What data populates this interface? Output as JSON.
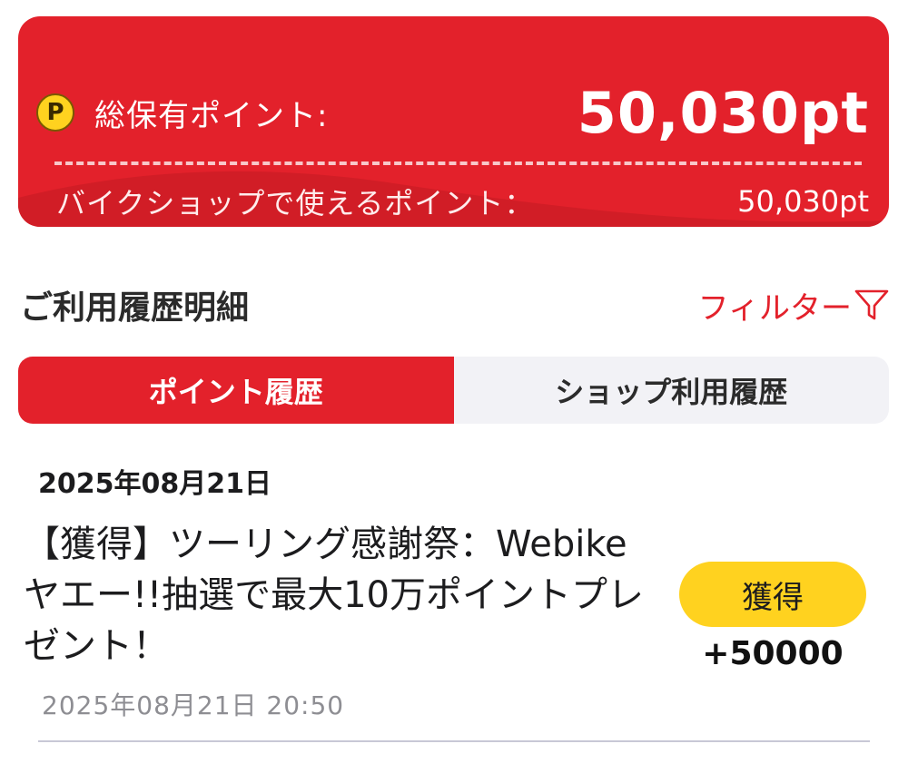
{
  "points_card": {
    "coin_symbol": "P",
    "total_label": "総保有ポイント:",
    "total_value": "50,030pt",
    "shop_label": "バイクショップで使えるポイント：",
    "shop_value": "50,030pt",
    "background_color": "#e3212b"
  },
  "history_section": {
    "title": "ご利用履歴明細",
    "filter_label": "フィルター",
    "filter_icon": "filter-funnel-icon",
    "accent_color": "#e3212b"
  },
  "tabs": [
    {
      "label": "ポイント履歴",
      "active": true
    },
    {
      "label": "ショップ利用履歴",
      "active": false
    }
  ],
  "entries": [
    {
      "date": "2025年08月21日",
      "description": "【獲得】ツーリング感謝祭：Webikeヤエー!!抽選で最大10万ポイントプレゼント！",
      "badge": "獲得",
      "badge_color": "#ffd21f",
      "points": "+50000",
      "timestamp": "2025年08月21日 20:50"
    }
  ]
}
